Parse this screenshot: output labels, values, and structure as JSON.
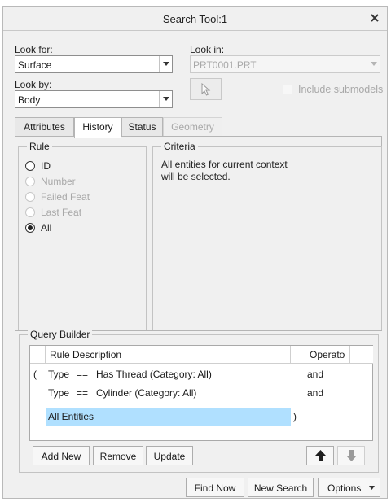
{
  "window": {
    "title": "Search Tool:1"
  },
  "look_for": {
    "label": "Look for:",
    "value": "Surface"
  },
  "look_by": {
    "label": "Look by:",
    "value": "Body"
  },
  "look_in": {
    "label": "Look in:",
    "value": "PRT0001.PRT"
  },
  "include_submodels": {
    "label": "Include submodels",
    "checked": false
  },
  "tabs": [
    {
      "label": "Attributes",
      "state": "normal"
    },
    {
      "label": "History",
      "state": "active"
    },
    {
      "label": "Status",
      "state": "normal"
    },
    {
      "label": "Geometry",
      "state": "disabled"
    }
  ],
  "rule": {
    "title": "Rule",
    "options": [
      {
        "label": "ID",
        "enabled": true,
        "checked": false
      },
      {
        "label": "Number",
        "enabled": false,
        "checked": false
      },
      {
        "label": "Failed Feat",
        "enabled": false,
        "checked": false
      },
      {
        "label": "Last Feat",
        "enabled": false,
        "checked": false
      },
      {
        "label": "All",
        "enabled": true,
        "checked": true
      }
    ]
  },
  "criteria": {
    "title": "Criteria",
    "line1": "All entities for current context",
    "line2": "will be selected."
  },
  "query_builder": {
    "title": "Query Builder",
    "columns": {
      "rule_description": "Rule Description",
      "operator": "Operato"
    },
    "rows": [
      {
        "open": "(",
        "attr": "Type",
        "op": "==",
        "value": "Has Thread (Category: All)",
        "close": "",
        "operator": "and"
      },
      {
        "open": "",
        "attr": "Type",
        "op": "==",
        "value": "Cylinder (Category: All)",
        "close": "",
        "operator": "and"
      },
      {
        "open": "",
        "attr": "",
        "op": "",
        "value": "All Entities",
        "close": ")",
        "operator": ""
      }
    ],
    "buttons": {
      "add_new": "Add New",
      "remove": "Remove",
      "update": "Update"
    }
  },
  "footer": {
    "find_now": "Find Now",
    "new_search": "New Search",
    "options": "Options"
  },
  "colors": {
    "selection": "#b0e0ff",
    "dialog_bg": "#f0f0f0"
  }
}
